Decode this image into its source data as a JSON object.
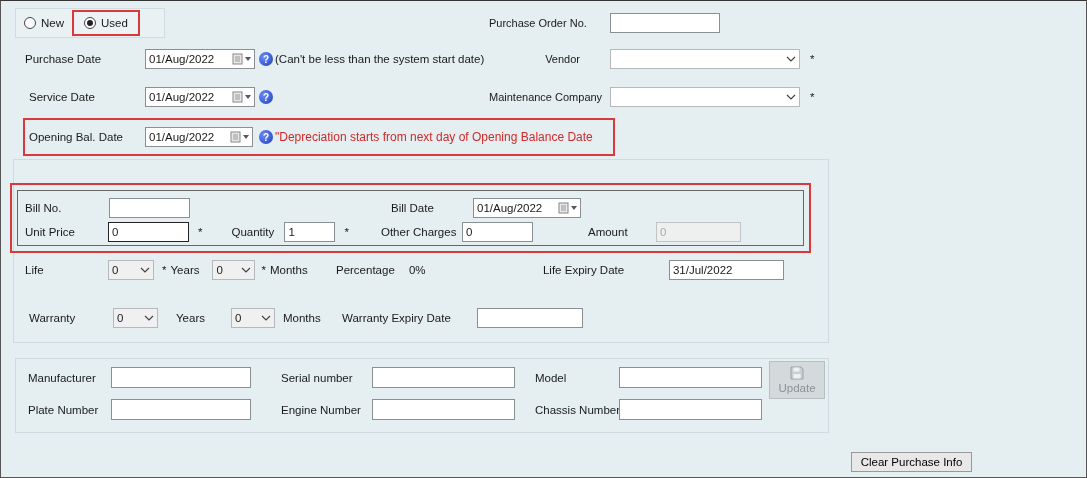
{
  "condition": [
    {
      "label": "New",
      "selected": false,
      "highlighted": false
    },
    {
      "label": "Used",
      "selected": true,
      "highlighted": true
    }
  ],
  "purchase_order": {
    "label": "Purchase Order No."
  },
  "purchase_date": {
    "label": "Purchase Date",
    "value": "01/Aug/2022",
    "help": "?",
    "note": "(Can't be less than the system start date)"
  },
  "vendor": {
    "label": "Vendor",
    "mark": "*"
  },
  "service_date": {
    "label": "Service Date",
    "value": "01/Aug/2022",
    "help": "?"
  },
  "maintenance_company": {
    "label": "Maintenance Company",
    "mark": "*"
  },
  "opening_bal_date": {
    "label": "Opening Bal. Date",
    "value": "01/Aug/2022",
    "help": "?",
    "note": "\"Depreciation starts from next day of Opening Balance Date",
    "highlighted": true
  },
  "bill": {
    "highlighted": true,
    "bill_no": {
      "label": "Bill No."
    },
    "bill_date": {
      "label": "Bill Date",
      "value": "01/Aug/2022"
    },
    "unit_price": {
      "label": "Unit Price",
      "value": "0",
      "mark": "*",
      "focused": true
    },
    "quantity": {
      "label": "Quantity",
      "value": "1",
      "mark": "*"
    },
    "other_charges": {
      "label": "Other Charges",
      "value": "0"
    },
    "amount": {
      "label": "Amount",
      "value": "0",
      "disabled": true
    }
  },
  "life": {
    "label": "Life",
    "years": "0",
    "years_mark": "*",
    "years_label": "Years",
    "months": "0",
    "months_mark": "*",
    "months_label": "Months"
  },
  "percentage": {
    "label": "Percentage",
    "value": "0%"
  },
  "life_expiry": {
    "label": "Life Expiry Date",
    "value": "31/Jul/2022"
  },
  "warranty": {
    "label": "Warranty",
    "years": "0",
    "years_label": "Years",
    "months": "0",
    "months_label": "Months"
  },
  "warranty_expiry": {
    "label": "Warranty Expiry Date"
  },
  "vehicle": [
    {
      "label": "Manufacturer"
    },
    {
      "label": "Serial number"
    },
    {
      "label": "Model"
    },
    {
      "label": "Plate Number"
    },
    {
      "label": "Engine Number"
    },
    {
      "label": "Chassis Number"
    }
  ],
  "update_button": {
    "label": "Update",
    "disabled": true
  },
  "clear_button": {
    "label": "Clear Purchase Info"
  }
}
